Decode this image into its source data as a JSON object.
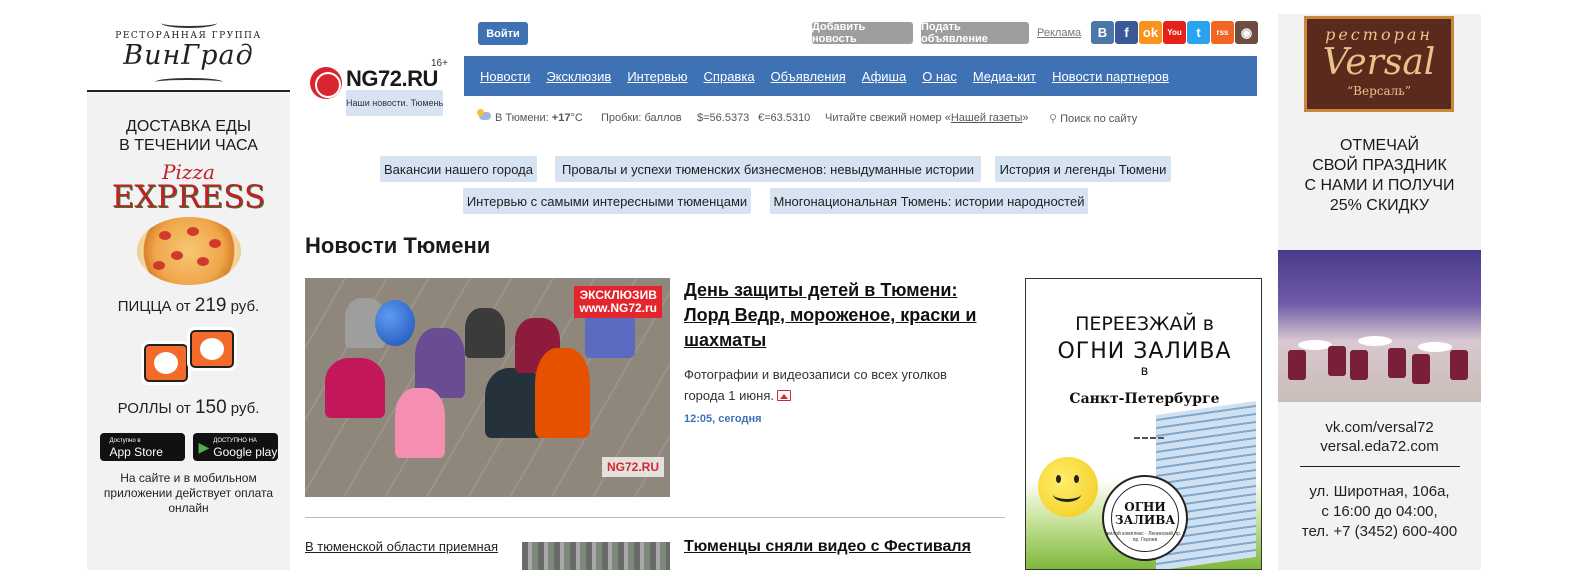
{
  "header": {
    "login_label": "Войти",
    "add_news_label": "Добавить новость",
    "post_ad_label": "Подать объявление",
    "ads_link": "Реклама",
    "socials": [
      {
        "name": "vk-icon",
        "glyph": "B",
        "color": "#4a76a8"
      },
      {
        "name": "facebook-icon",
        "glyph": "f",
        "color": "#3b5998"
      },
      {
        "name": "odnoklassniki-icon",
        "glyph": "ok",
        "color": "#f7931e"
      },
      {
        "name": "youtube-icon",
        "glyph": "You",
        "color": "#e62117"
      },
      {
        "name": "twitter-icon",
        "glyph": "t",
        "color": "#2aa3ef"
      },
      {
        "name": "rss-icon",
        "glyph": "rss",
        "color": "#f26522"
      },
      {
        "name": "instagram-icon",
        "glyph": "◉",
        "color": "#6d4c41"
      }
    ]
  },
  "logo": {
    "name": "NG72.RU",
    "tagline": "Наши новости. Тюмень",
    "age": "16+"
  },
  "nav": [
    "Новости",
    "Эксклюзив",
    "Интервью",
    "Справка",
    "Объявления",
    "Афиша",
    "О нас",
    "Медиа-кит",
    "Новости партнеров"
  ],
  "info": {
    "weather_prefix": "В Тюмени: ",
    "temperature": "+17",
    "temp_unit": "°C",
    "traffic": "Пробки: баллов",
    "usd": "$=56.5373",
    "eur": "€=63.5310",
    "paper_prefix": "Читайте свежий номер «",
    "paper_link": "Нашей газеты",
    "paper_suffix": "»",
    "search_placeholder": "Поиск по сайту"
  },
  "tags": [
    "Вакансии нашего города",
    "Провалы и успехи тюменских бизнесменов: невыдуманные истории",
    "История и легенды Тюмени",
    "Интервью с самыми интересными тюменцами",
    "Многонациональная Тюмень: истории народностей"
  ],
  "section_title": "Новости Тюмени",
  "main_news": {
    "badge_line1": "ЭКСКЛЮЗИВ",
    "badge_line2": "www.NG72.ru",
    "watermark": "NG72.RU",
    "title": "День защиты детей в Тюмени: Лорд Ведр, мороженое, краски и шахматы",
    "lead": "Фотографии и видеозаписи со всех уголков города 1 июня.",
    "time": "12:05, сегодня"
  },
  "second_news": {
    "side_link": "В тюменской области приемная",
    "title": "Тюменцы сняли видео с Фестиваля"
  },
  "left_banner": {
    "group": "РЕСТОРАННАЯ ГРУППА",
    "brand": "ВинГрад",
    "delivery_line1": "ДОСТАВКА ЕДЫ",
    "delivery_line2": "В ТЕЧЕНИИ ЧАСА",
    "pizza_word": "Pizza",
    "express_word": "EXPRESS",
    "pizza_prefix": "ПИЦЦА от ",
    "pizza_price": "219",
    "price_suffix": " руб.",
    "rolls_prefix": "РОЛЛЫ от ",
    "rolls_price": "150",
    "appstore_small": "Доступно в",
    "appstore": "App Store",
    "googleplay_small": "ДОСТУПНО НА",
    "googleplay": "Google play",
    "note": "На сайте и в мобильном приложении действует оплата онлайн"
  },
  "right_banner": {
    "restaurant_word": "ресторан",
    "brand": "Versal",
    "brand_ru": "“Версаль”",
    "offer_lines": [
      "ОТМЕЧАЙ",
      "СВОЙ ПРАЗДНИК",
      "С НАМИ И ПОЛУЧИ",
      "25% СКИДКУ"
    ],
    "vk": "vk.com/versal72",
    "site": "versal.eda72.com",
    "address": "ул. Широтная, 106а,",
    "hours": "с 16:00 до 04:00,",
    "phone": "тел. +7 (3452) 600-400"
  },
  "center_ad": {
    "move_line1": "ПЕРЕЕЗЖАЙ в",
    "move_line2": "ОГНИ ЗАЛИВА",
    "move_line3": "в",
    "city": "Санкт-Петербурге",
    "seal_line1": "ОГНИ",
    "seal_line2": "ЗАЛИВА",
    "seal_ring": "жилой комплекс · Ленинский пр. / пр. Героев"
  }
}
